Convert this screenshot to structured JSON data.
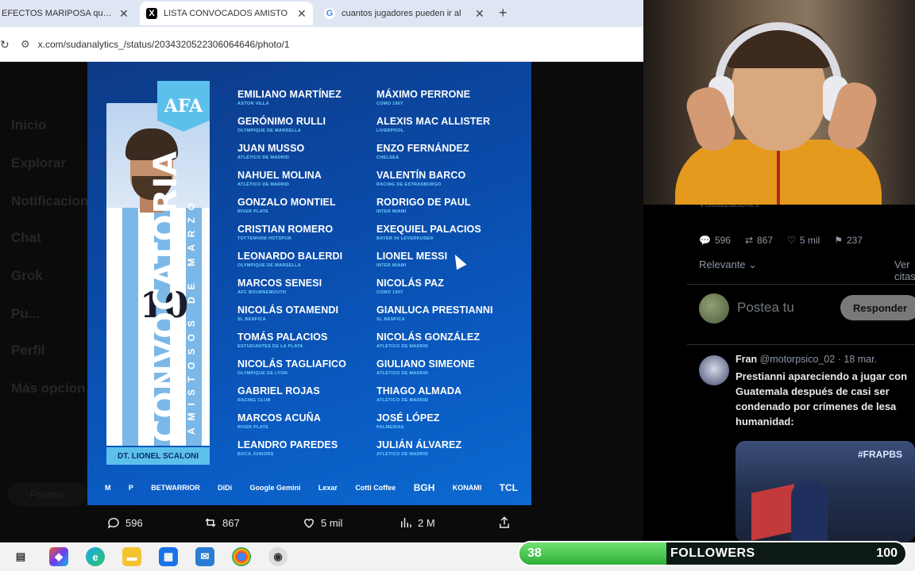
{
  "browser": {
    "tabs": [
      {
        "title": "EFECTOS MARIPOSA que al",
        "favicon": "x-icon"
      },
      {
        "title": "LISTA CONVOCADOS AMISTO",
        "favicon": "x-icon"
      },
      {
        "title": "cuantos jugadores pueden ir al",
        "favicon": "google-icon"
      }
    ],
    "url": "x.com/sudanalytics_/status/2034320522306064646/photo/1"
  },
  "sidebar": [
    "Inicio",
    "Explorar",
    "Notificacion",
    "Chat",
    "Grok",
    "Pu...",
    "Perfil",
    "Más opcion"
  ],
  "sidebar_post": "Postear",
  "graphic": {
    "badge": "AFA",
    "title": "CONVOCATORIA",
    "subtitle": "AMISTOSOS DE MARZO",
    "coach": "DT. LIONEL SCALONI",
    "jersey_number": "10",
    "col1": [
      {
        "name": "EMILIANO MARTÍNEZ",
        "club": "ASTON VILLA"
      },
      {
        "name": "GERÓNIMO RULLI",
        "club": "OLYMPIQUE DE MARSELLA"
      },
      {
        "name": "JUAN MUSSO",
        "club": "ATLÉTICO DE MADRID"
      },
      {
        "name": "NAHUEL MOLINA",
        "club": "ATLÉTICO DE MADRID"
      },
      {
        "name": "GONZALO MONTIEL",
        "club": "RIVER PLATE"
      },
      {
        "name": "CRISTIAN ROMERO",
        "club": "TOTTENHAM HOTSPUR"
      },
      {
        "name": "LEONARDO BALERDI",
        "club": "OLYMPIQUE DE MARSELLA"
      },
      {
        "name": "MARCOS SENESI",
        "club": "AFC BOURNEMOUTH"
      },
      {
        "name": "NICOLÁS OTAMENDI",
        "club": "SL BENFICA"
      },
      {
        "name": "TOMÁS PALACIOS",
        "club": "ESTUDIANTES DE LA PLATA"
      },
      {
        "name": "NICOLÁS TAGLIAFICO",
        "club": "OLYMPIQUE DE LYON"
      },
      {
        "name": "GABRIEL ROJAS",
        "club": "RACING CLUB"
      },
      {
        "name": "MARCOS ACUÑA",
        "club": "RIVER PLATE"
      },
      {
        "name": "LEANDRO PAREDES",
        "club": "BOCA JUNIORS"
      }
    ],
    "col2": [
      {
        "name": "MÁXIMO PERRONE",
        "club": "COMO 1907"
      },
      {
        "name": "ALEXIS MAC ALLISTER",
        "club": "LIVERPOOL"
      },
      {
        "name": "ENZO FERNÁNDEZ",
        "club": "CHELSEA"
      },
      {
        "name": "VALENTÍN BARCO",
        "club": "RACING DE ESTRASBURGO"
      },
      {
        "name": "RODRIGO DE PAUL",
        "club": "INTER MIAMI"
      },
      {
        "name": "EXEQUIEL PALACIOS",
        "club": "BAYER 04 LEVERKUSEN"
      },
      {
        "name": "LIONEL MESSI",
        "club": "INTER MIAMI"
      },
      {
        "name": "NICOLÁS PAZ",
        "club": "COMO 1907"
      },
      {
        "name": "GIANLUCA PRESTIANNI",
        "club": "SL BENFICA"
      },
      {
        "name": "NICOLÁS GONZÁLEZ",
        "club": "ATLÉTICO DE MADRID"
      },
      {
        "name": "GIULIANO SIMEONE",
        "club": "ATLÉTICO DE MADRID"
      },
      {
        "name": "THIAGO ALMADA",
        "club": "ATLÉTICO DE MADRID"
      },
      {
        "name": "JOSÉ LÓPEZ",
        "club": "PALMEIRAS"
      },
      {
        "name": "JULIÁN ÁLVAREZ",
        "club": "ATLÉTICO DE MADRID"
      }
    ],
    "sponsors": [
      "M",
      "P",
      "BETWARRIOR",
      "DiDi",
      "Google Gemini",
      "Lexar",
      "Cotti Coffee",
      "BGH",
      "KONAMI",
      "TCL"
    ]
  },
  "photo_actions": {
    "replies": "596",
    "reposts": "867",
    "likes": "5 mil",
    "views": "2 M"
  },
  "right_panel": {
    "header_fragment": "Visualizaciones",
    "stats": {
      "replies": "596",
      "reposts": "867",
      "likes": "5 mil",
      "bookmarks": "237"
    },
    "sort": "Relevante",
    "quotes": "Ver citas",
    "compose_placeholder": "Postea tu",
    "reply_button": "Responder",
    "reply": {
      "name": "Fran",
      "handle": "@motorpsico_02 · 18 mar.",
      "text": "Prestianni apareciendo a jugar con Guatemala después de casi ser condenado por crímenes de lesa humanidad:",
      "media_tag": "#FRAPBS"
    }
  },
  "followers": {
    "current": "38",
    "label": "FOLLOWERS",
    "goal": "100",
    "progress": 0.38
  },
  "colors": {
    "accent": "#5cc0ec",
    "graphic_bg": "#0a4aa8",
    "progress": "#2fae39"
  }
}
